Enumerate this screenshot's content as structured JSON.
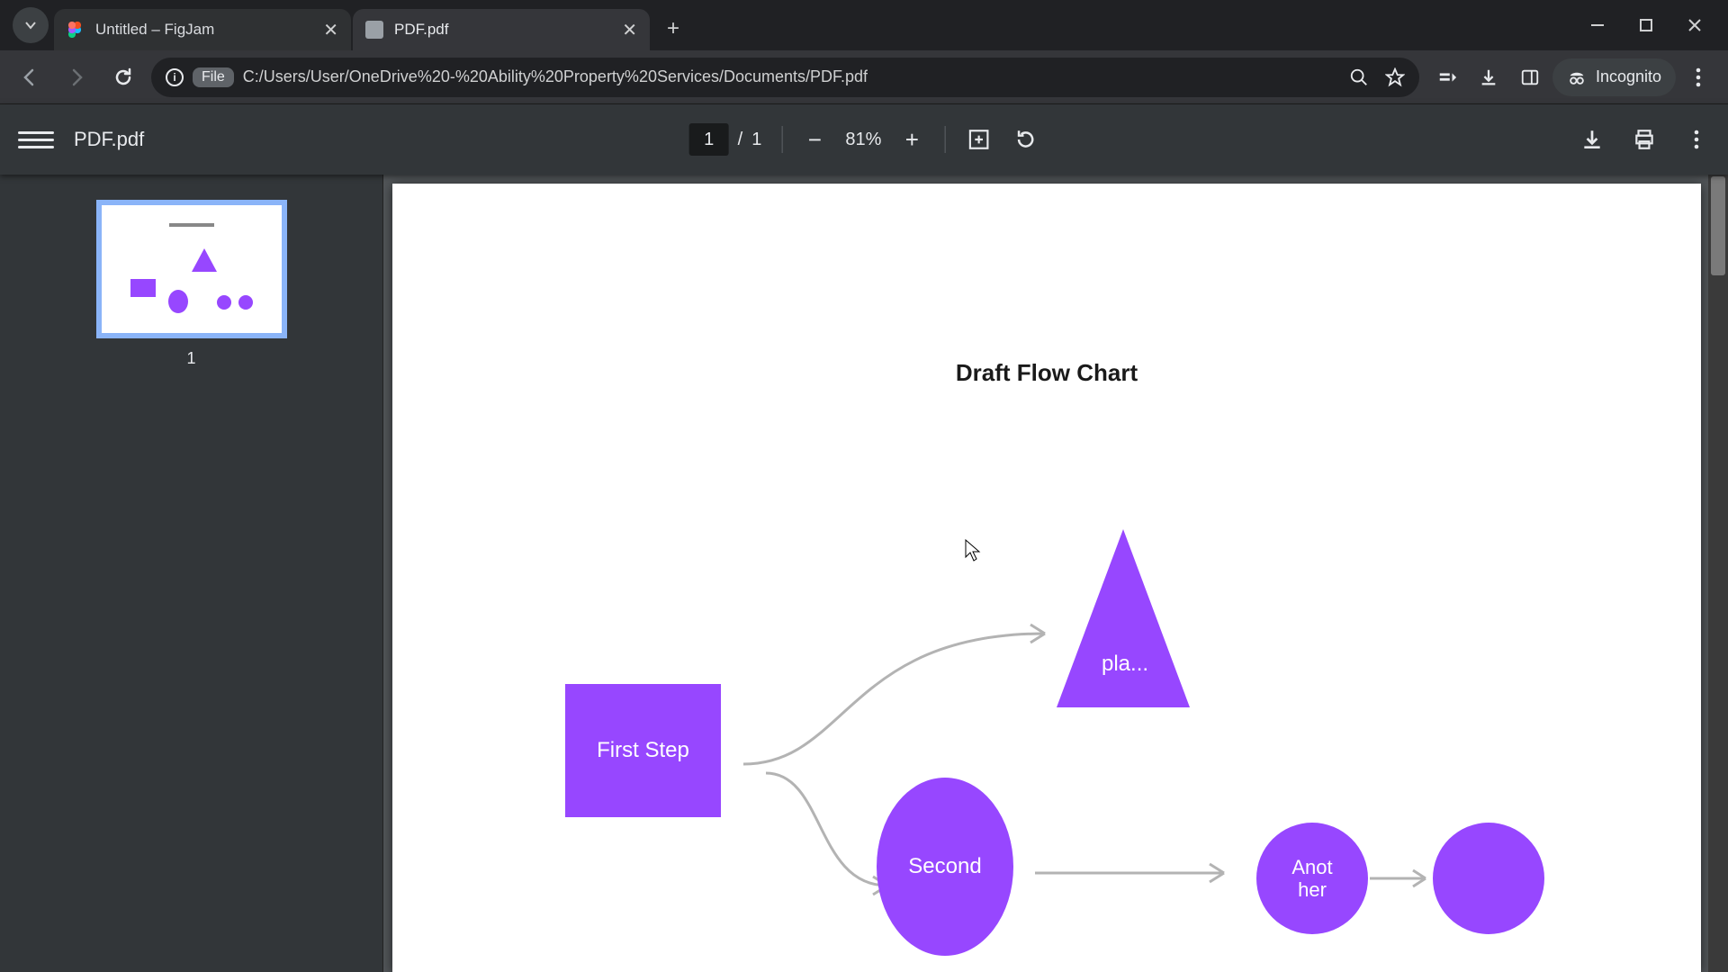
{
  "tabs": [
    {
      "title": "Untitled – FigJam",
      "active": false
    },
    {
      "title": "PDF.pdf",
      "active": true
    }
  ],
  "omnibox": {
    "chip": "File",
    "url": "C:/Users/User/OneDrive%20-%20Ability%20Property%20Services/Documents/PDF.pdf"
  },
  "incognito_label": "Incognito",
  "pdfbar": {
    "filename": "PDF.pdf",
    "page_current": "1",
    "page_sep": "/",
    "page_total": "1",
    "zoom": "81%"
  },
  "thumbnail": {
    "number": "1"
  },
  "document": {
    "title": "Draft Flow Chart",
    "shapes": {
      "rect_label": "First Step",
      "triangle_label": "pla...",
      "ellipse_label": "Second",
      "circle1_line1": "Anot",
      "circle1_line2": "her"
    }
  }
}
